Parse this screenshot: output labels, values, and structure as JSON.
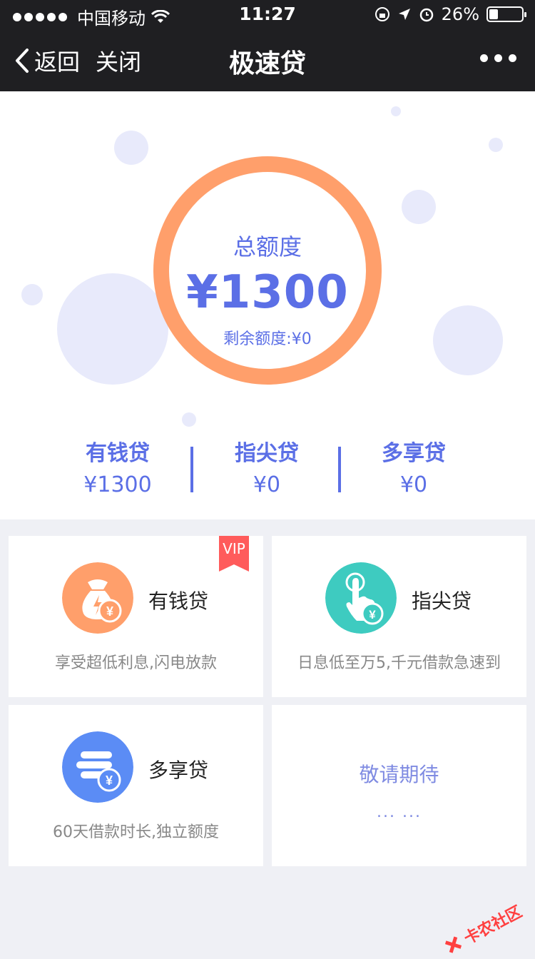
{
  "status": {
    "carrier": "中国移动",
    "time": "11:27",
    "battery": "26%"
  },
  "nav": {
    "back_label": "返回",
    "close_label": "关闭",
    "title": "极速贷"
  },
  "hero": {
    "total_label": "总额度",
    "total_amount": "¥1300",
    "remaining": "剩余额度:¥0"
  },
  "stats": [
    {
      "name": "有钱贷",
      "value": "¥1300"
    },
    {
      "name": "指尖贷",
      "value": "¥0"
    },
    {
      "name": "多享贷",
      "value": "¥0"
    }
  ],
  "cards": [
    {
      "name": "有钱贷",
      "desc": "享受超低利息,闪电放款",
      "badge": "VIP",
      "icon": "money-bag-icon",
      "color": "#ff9f6b"
    },
    {
      "name": "指尖贷",
      "desc": "日息低至万5,千元借款急速到",
      "icon": "finger-tap-icon",
      "color": "#3ecbc0"
    },
    {
      "name": "多享贷",
      "desc": "60天借款时长,独立额度",
      "icon": "coin-stack-icon",
      "color": "#5b8cf5"
    },
    {
      "title": "敬请期待",
      "dots": "... ..."
    }
  ],
  "watermark": "卡农社区",
  "colors": {
    "accent": "#5b6fe6",
    "ring": "#ff9f6b",
    "nav_bg": "#1f1f22"
  }
}
